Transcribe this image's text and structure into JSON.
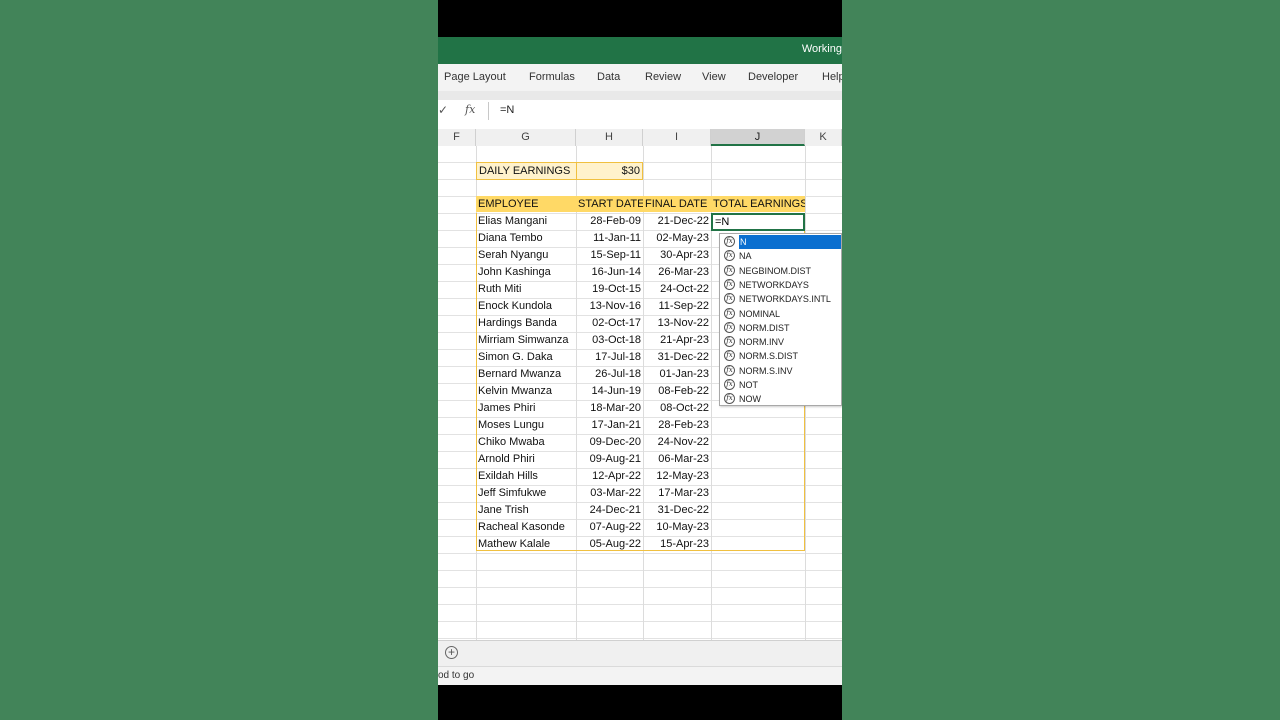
{
  "window": {
    "title": "Working"
  },
  "ribbon": {
    "tabs": [
      "Page Layout",
      "Formulas",
      "Data",
      "Review",
      "View",
      "Developer",
      "Help"
    ]
  },
  "formula_bar": {
    "check": "✓",
    "fx": "fx",
    "value": "=N"
  },
  "columns": [
    "F",
    "G",
    "H",
    "I",
    "J",
    "K"
  ],
  "sheet": {
    "daily_label": "DAILY EARNINGS",
    "daily_value": "$30",
    "headers": [
      "EMPLOYEE",
      "START DATE",
      "FINAL DATE",
      "TOTAL EARNINGS"
    ],
    "rows": [
      [
        "Elias Mangani",
        "28-Feb-09",
        "21-Dec-22"
      ],
      [
        "Diana Tembo",
        "11-Jan-11",
        "02-May-23"
      ],
      [
        "Serah Nyangu",
        "15-Sep-11",
        "30-Apr-23"
      ],
      [
        "John Kashinga",
        "16-Jun-14",
        "26-Mar-23"
      ],
      [
        "Ruth Miti",
        "19-Oct-15",
        "24-Oct-22"
      ],
      [
        "Enock Kundola",
        "13-Nov-16",
        "11-Sep-22"
      ],
      [
        "Hardings Banda",
        "02-Oct-17",
        "13-Nov-22"
      ],
      [
        "Mirriam Simwanza",
        "03-Oct-18",
        "21-Apr-23"
      ],
      [
        "Simon G. Daka",
        "17-Jul-18",
        "31-Dec-22"
      ],
      [
        "Bernard Mwanza",
        "26-Jul-18",
        "01-Jan-23"
      ],
      [
        "Kelvin Mwanza",
        "14-Jun-19",
        "08-Feb-22"
      ],
      [
        "James Phiri",
        "18-Mar-20",
        "08-Oct-22"
      ],
      [
        "Moses Lungu",
        "17-Jan-21",
        "28-Feb-23"
      ],
      [
        "Chiko Mwaba",
        "09-Dec-20",
        "24-Nov-22"
      ],
      [
        "Arnold Phiri",
        "09-Aug-21",
        "06-Mar-23"
      ],
      [
        "Exildah Hills",
        "12-Apr-22",
        "12-May-23"
      ],
      [
        "Jeff Simfukwe",
        "03-Mar-22",
        "17-Mar-23"
      ],
      [
        "Jane Trish",
        "24-Dec-21",
        "31-Dec-22"
      ],
      [
        "Racheal Kasonde",
        "07-Aug-22",
        "10-May-23"
      ],
      [
        "Mathew Kalale",
        "05-Aug-22",
        "15-Apr-23"
      ]
    ],
    "active_cell_value": "=N"
  },
  "autocomplete": {
    "icon_label": "fx",
    "items": [
      "N",
      "NA",
      "NEGBINOM.DIST",
      "NETWORKDAYS",
      "NETWORKDAYS.INTL",
      "NOMINAL",
      "NORM.DIST",
      "NORM.INV",
      "NORM.S.DIST",
      "NORM.S.INV",
      "NOT",
      "NOW"
    ],
    "selected_index": 0
  },
  "sheetbar": {
    "add_symbol": "+"
  },
  "status": {
    "text": "od to go"
  },
  "colors": {
    "excel_green": "#217346",
    "header_yellow": "#ffd966",
    "selected_blue": "#0a6fd0",
    "background_green": "#428459"
  }
}
